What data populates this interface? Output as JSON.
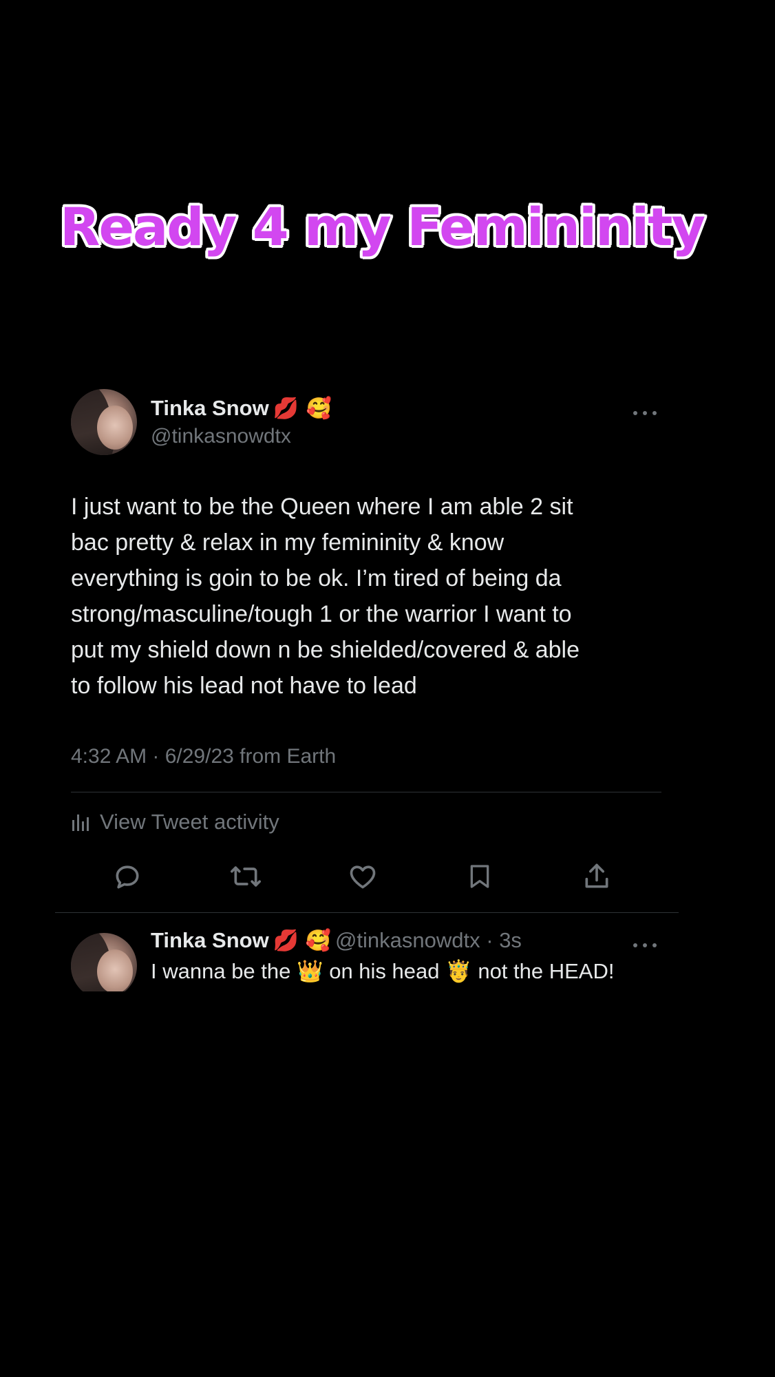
{
  "overlay": {
    "title": "Ready 4 my Femininity",
    "title_color": "#d247f0"
  },
  "tweet": {
    "author_name": "Tinka Snow",
    "author_emojis": "💋 🥰",
    "author_handle": "@tinkasnowdtx",
    "text": "I just want to be the Queen where I am able 2 sit\nbac pretty & relax in my femininity & know\neverything is goin to be ok. I’m tired of being da\nstrong/masculine/tough 1 or the warrior I want to\nput my shield down n be shielded/covered & able\nto follow his lead not have to lead",
    "meta": "4:32 AM · 6/29/23 from Earth",
    "activity_label": "View Tweet activity",
    "icons": [
      "reply-icon",
      "retweet-icon",
      "like-icon",
      "bookmark-icon",
      "share-icon"
    ]
  },
  "reply": {
    "author_name": "Tinka Snow",
    "author_emojis": "💋 🥰",
    "author_handle": "@tinkasnowdtx",
    "separator": " · ",
    "time": "3s",
    "text": "I wanna be the 👑 on his head  🤴 not the HEAD!"
  },
  "colors": {
    "background": "#000000",
    "primary_text": "#e7e9ea",
    "secondary_text": "#71767b",
    "divider": "#2f3336"
  }
}
